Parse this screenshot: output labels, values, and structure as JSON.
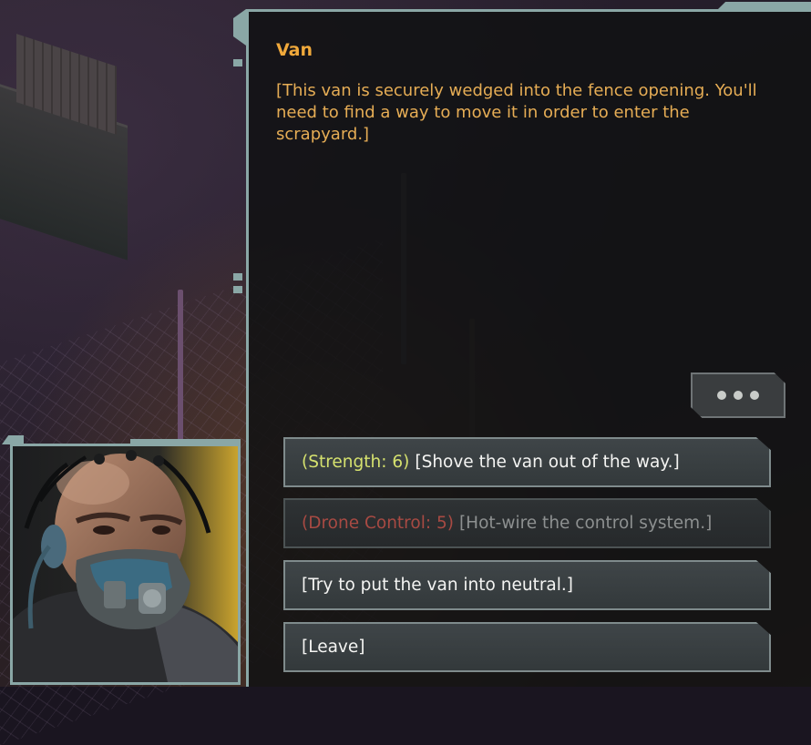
{
  "dialog": {
    "speaker": "Van",
    "narration": "[This van is securely wedged into the fence opening. You'll need to find a way to move it in order to enter the scrapyard.]",
    "more_button_icon": "ellipsis-icon"
  },
  "options": [
    {
      "tag": "(Strength: 6)",
      "text": "[Shove the van out of the way.]",
      "enabled": true
    },
    {
      "tag": "(Drone Control: 5)",
      "text": "[Hot-wire the control system.]",
      "enabled": false
    },
    {
      "tag": "",
      "text": "[Try to put the van into neutral.]",
      "enabled": true
    },
    {
      "tag": "",
      "text": "[Leave]",
      "enabled": true
    }
  ],
  "colors": {
    "frame_accent": "#8aa7a6",
    "speaker": "#f0a93b",
    "narration": "#e6ad55",
    "skill_check_pass": "#d5e16e",
    "skill_check_fail": "#a84a43"
  },
  "portrait": {
    "icon": "character-portrait"
  }
}
